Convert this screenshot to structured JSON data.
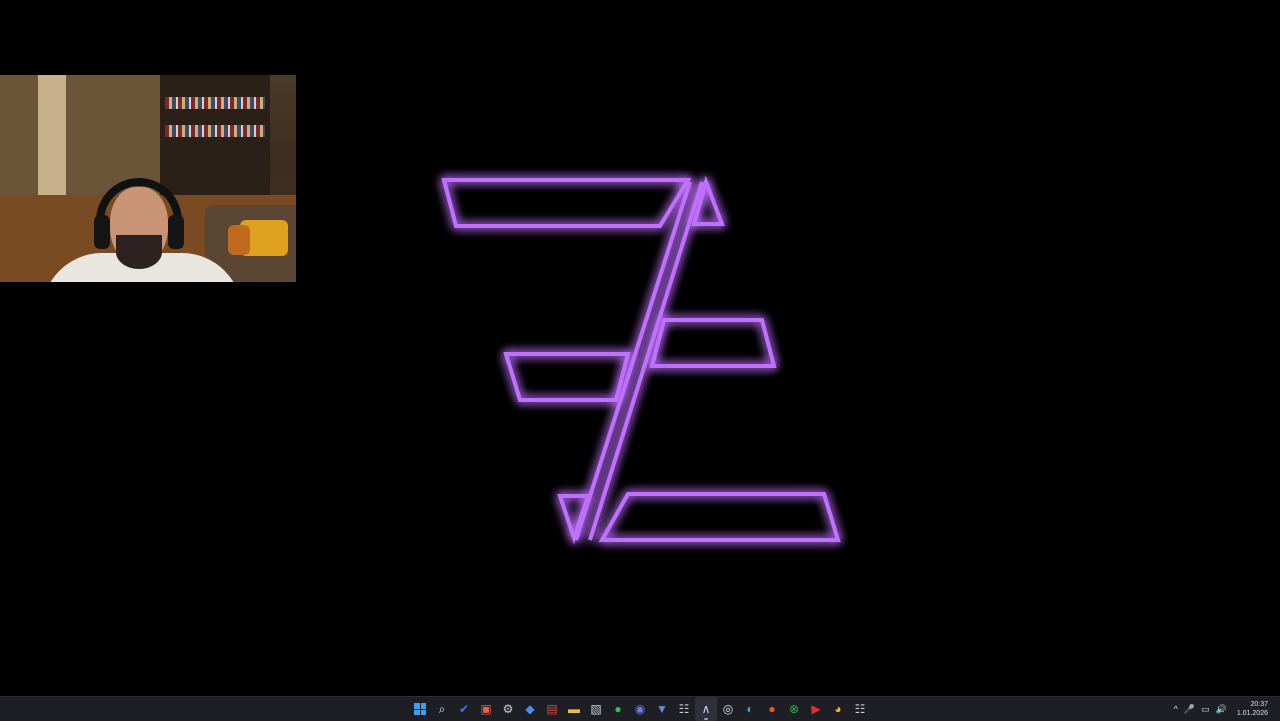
{
  "desktop": {
    "logo_color": "#b14dff",
    "logo_glow": "#9a3df0"
  },
  "taskbar": {
    "pinned": [
      {
        "name": "start-button",
        "icon": "windows-icon",
        "color": "#3fa0f0"
      },
      {
        "name": "search-button",
        "icon": "search-icon",
        "color": "#e6e6e6"
      },
      {
        "name": "todo-app",
        "icon": "checkmark-icon",
        "color": "#2f7ef0"
      },
      {
        "name": "photos-app",
        "icon": "photos-icon",
        "color": "#e8604a"
      },
      {
        "name": "settings-app",
        "icon": "gear-icon",
        "color": "#cfcfcf"
      },
      {
        "name": "app-blue-diamond",
        "icon": "diamond-icon",
        "color": "#4a8ef0"
      },
      {
        "name": "calendar-app",
        "icon": "calendar-icon",
        "color": "#d94a3a"
      },
      {
        "name": "file-explorer",
        "icon": "folder-icon",
        "color": "#f0c040"
      },
      {
        "name": "app-gift",
        "icon": "gift-icon",
        "color": "#cfcfcf"
      },
      {
        "name": "whatsapp-app",
        "icon": "whatsapp-icon",
        "color": "#30c050"
      },
      {
        "name": "discord-app",
        "icon": "discord-icon",
        "color": "#6a7af0"
      },
      {
        "name": "app-shield",
        "icon": "shield-icon",
        "color": "#6a8ad0"
      },
      {
        "name": "app-grid",
        "icon": "grid-icon",
        "color": "#cfcfcf"
      },
      {
        "name": "app-active-logo",
        "icon": "logo-icon",
        "color": "#d0d0ff",
        "active": true
      },
      {
        "name": "obs-app",
        "icon": "record-icon",
        "color": "#e0e0e0"
      },
      {
        "name": "edge-app",
        "icon": "browser-icon",
        "color": "#3aa0e0"
      },
      {
        "name": "app-orange-circle",
        "icon": "circle-icon",
        "color": "#e85a20"
      },
      {
        "name": "xbox-app",
        "icon": "xbox-icon",
        "color": "#30b040"
      },
      {
        "name": "app-red",
        "icon": "youtube-icon",
        "color": "#e03030"
      },
      {
        "name": "chrome-app",
        "icon": "chrome-icon",
        "color": "#f0c020"
      },
      {
        "name": "app-grid-2",
        "icon": "grid-icon",
        "color": "#cfcfcf"
      }
    ],
    "tray": {
      "chevron": "^",
      "time": "20:37",
      "date": "1.01.2026"
    }
  }
}
